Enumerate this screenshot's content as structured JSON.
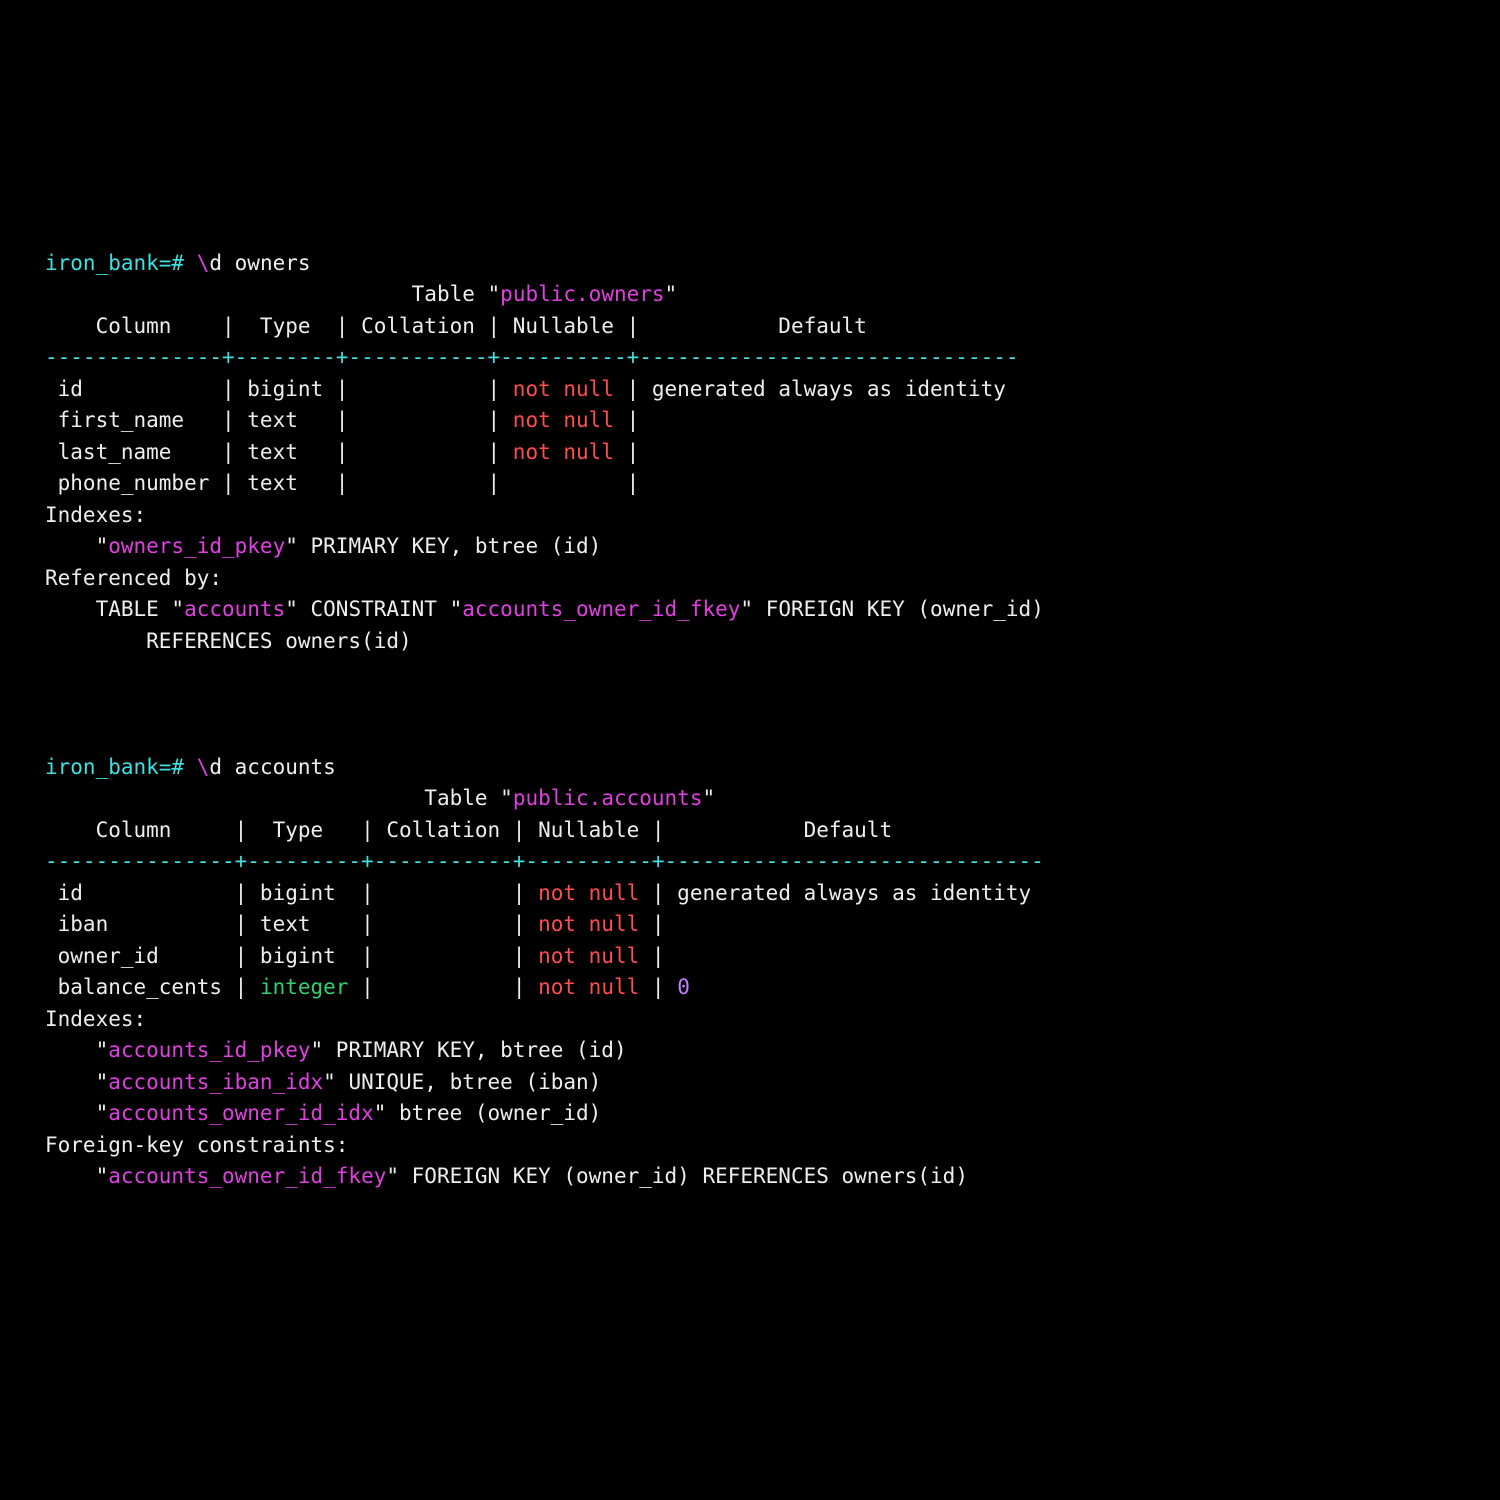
{
  "prompt1": "iron_bank=# ",
  "slash": "\\",
  "cmd1": "d owners",
  "owners": {
    "title_pre": "Table \"",
    "title_name": "public.owners",
    "title_post": "\"",
    "header": "    Column    |  Type  | Collation | Nullable |           Default            ",
    "rule": "--------------+--------+-----------+----------+------------------------------",
    "rows": [
      {
        "left": " id           | bigint |           | ",
        "null": "not null",
        "right": " | generated always as identity "
      },
      {
        "left": " first_name   | text   |           | ",
        "null": "not null",
        "right": " |  "
      },
      {
        "left": " last_name    | text   |           | ",
        "null": "not null",
        "right": " |  "
      },
      {
        "left": " phone_number | text   |           | ",
        "right": "         |  "
      }
    ],
    "indexes_label": "Indexes:",
    "index_q1": "    \"",
    "index_name": "owners_id_pkey",
    "index_q2": "\" PRIMARY KEY, btree (id)",
    "ref_label": "Referenced by:",
    "ref_l1a": "    TABLE \"",
    "ref_l1b": "accounts",
    "ref_l1c": "\" CONSTRAINT \"",
    "ref_l1d": "accounts_owner_id_fkey",
    "ref_l1e": "\" FOREIGN KEY (owner_id) ",
    "ref_l2": "        REFERENCES owners(id)"
  },
  "prompt2": "iron_bank=# ",
  "cmd2": "d accounts",
  "accounts": {
    "title_pre": "Table \"",
    "title_name": "public.accounts",
    "title_post": "\"",
    "header": "    Column     |  Type   | Collation | Nullable |           Default            ",
    "rule": "---------------+---------+-----------+----------+------------------------------",
    "rows": [
      {
        "left": " id            | bigint  |           | ",
        "null": "not null",
        "right": " | generated always as identity "
      },
      {
        "left": " iban          | text    |           | ",
        "null": "not null",
        "right": " |  "
      },
      {
        "left": " owner_id      | bigint  |           | ",
        "null": "not null",
        "right": " |  "
      },
      {
        "left": " balance_cents | ",
        "int": "integer",
        "mid": " |           | ",
        "null": "not null",
        "after": " | ",
        "zero": "0",
        "right": ""
      }
    ],
    "indexes_label": "Indexes:",
    "idx1_q1": "    \"",
    "idx1_name": "accounts_id_pkey",
    "idx1_q2": "\" PRIMARY KEY, btree (id)",
    "idx2_q1": "    \"",
    "idx2_name": "accounts_iban_idx",
    "idx2_q2": "\" UNIQUE, btree (iban)",
    "idx3_q1": "    \"",
    "idx3_name": "accounts_owner_id_idx",
    "idx3_q2": "\" btree (owner_id)",
    "fk_label": "Foreign-key constraints:",
    "fk_q1": "    \"",
    "fk_name": "accounts_owner_id_fkey",
    "fk_q2": "\" FOREIGN KEY (owner_id) REFERENCES owners(id)"
  }
}
